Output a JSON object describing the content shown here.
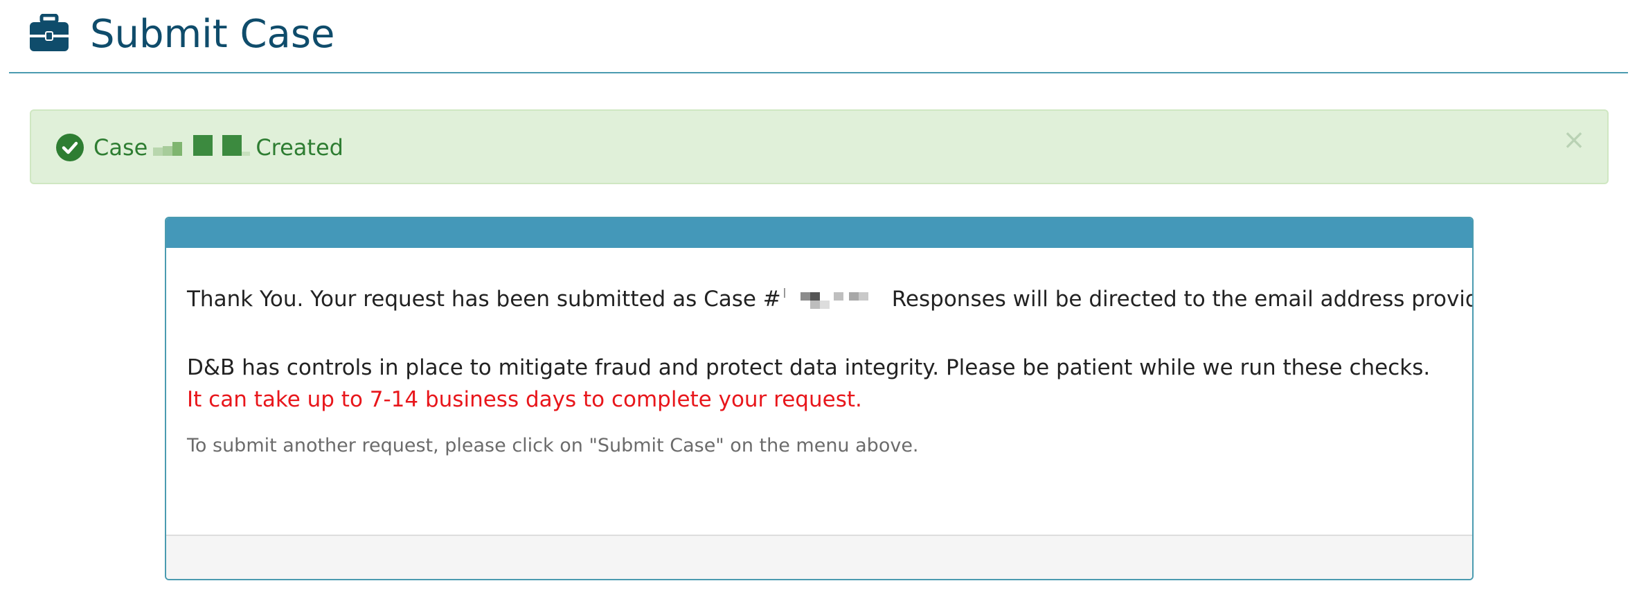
{
  "header": {
    "title": "Submit Case",
    "icon": "briefcase-icon",
    "title_color": "#0f4c6b"
  },
  "alert": {
    "prefix": "Case",
    "suffix": "Created",
    "icon": "check-circle-icon",
    "close_label": "×",
    "background": "#e0f0d9",
    "text_color": "#2e7d32"
  },
  "panel": {
    "heading_color": "#4498b9",
    "line1_prefix": "Thank You. Your request has been submitted as Case #",
    "line1_suffix": "Responses will be directed to the email address provided.",
    "para2_main": "D&B has controls in place to mitigate fraud and protect data integrity. Please be patient while we run these checks.",
    "para2_warning": "It can take up to 7-14 business days to complete your request.",
    "warning_color": "#e8161b",
    "hint": "To submit another request, please click on \"Submit Case\" on the menu above."
  }
}
